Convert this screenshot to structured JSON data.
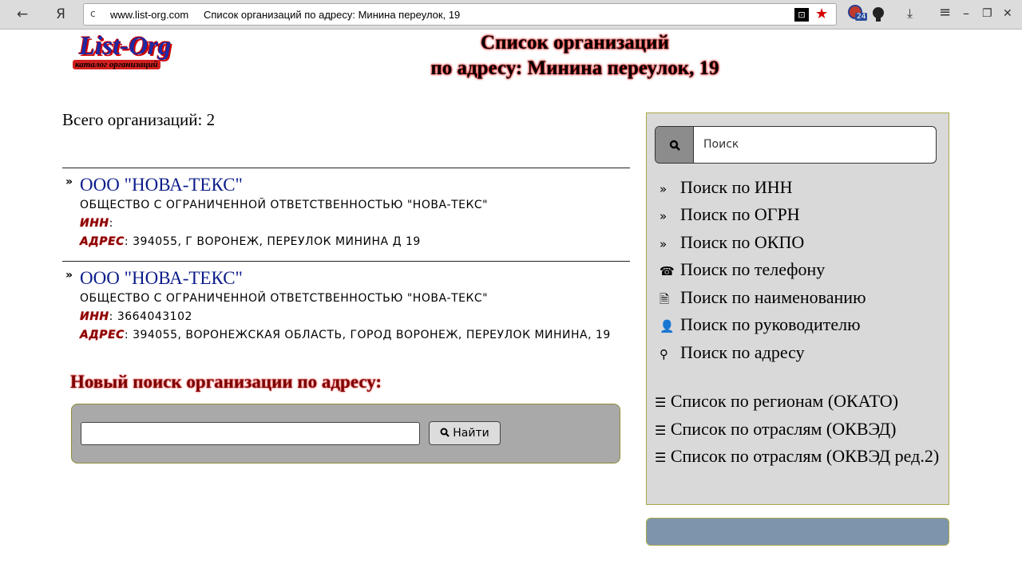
{
  "browser": {
    "back_icon": "←",
    "yandex_icon": "Я",
    "reload_icon": "c",
    "domain": "www.list-org.com",
    "tab_title": "Список организаций по адресу: Минина переулок, 19",
    "reader_icon": "⊡",
    "star_icon": "★",
    "badge_count": "24",
    "download_icon": "⤓",
    "menu_icon": "≡",
    "minimize_icon": "–",
    "restore_icon": "❐",
    "close_icon": "✕"
  },
  "logo": {
    "main": "List-Org",
    "tagline": "каталог организаций"
  },
  "header": {
    "title_line1": "Список организаций",
    "title_line2": "по адресу: Минина переулок, 19"
  },
  "total": {
    "text": "Всего организаций: 2"
  },
  "orgs": [
    {
      "name": "ООО \"НОВА-ТЕКС\"",
      "full_name": "ОБЩЕСТВО С ОГРАНИЧЕННОЙ ОТВЕТСТВЕННОСТЬЮ \"НОВА-ТЕКС\"",
      "inn_label": "ИНН",
      "inn_value": ":",
      "address_label": "АДРЕС",
      "address_value": ": 394055, Г ВОРОНЕЖ, ПЕРЕУЛОК МИНИНА Д 19"
    },
    {
      "name": "ООО \"НОВА-ТЕКС\"",
      "full_name": "ОБЩЕСТВО С ОГРАНИЧЕННОЙ ОТВЕТСТВЕННОСТЬЮ \"НОВА-ТЕКС\"",
      "inn_label": "ИНН",
      "inn_value": ": 3664043102",
      "address_label": "АДРЕС",
      "address_value": ": 394055, ВОРОНЕЖСКАЯ ОБЛАСТЬ, ГОРОД ВОРОНЕЖ, ПЕРЕУЛОК МИНИНА, 19"
    }
  ],
  "new_search": {
    "title": "Новый поиск организации по адресу:",
    "input_value": "",
    "button_label": "Найти",
    "button_icon": "🔍"
  },
  "sidebar": {
    "search_placeholder": "Поиск",
    "search_icon": "🔍",
    "links": [
      {
        "icon": "»",
        "label": "Поиск по ИНН"
      },
      {
        "icon": "»",
        "label": "Поиск по ОГРН"
      },
      {
        "icon": "»",
        "label": "Поиск по ОКПО"
      },
      {
        "icon": "☎",
        "label": "Поиск по телефону"
      },
      {
        "icon": "🗎",
        "label": "Поиск по наименованию"
      },
      {
        "icon": "👤",
        "label": "Поиск по руководителю"
      },
      {
        "icon": "⚲",
        "label": "Поиск по адресу"
      }
    ],
    "lists": [
      {
        "icon": "☰",
        "label": "Список по регионам (ОКАТО)"
      },
      {
        "icon": "☰",
        "label": "Список по отраслям (ОКВЭД)"
      },
      {
        "icon": "☰",
        "label": "Список по отраслям (ОКВЭД ред.2)"
      }
    ]
  }
}
